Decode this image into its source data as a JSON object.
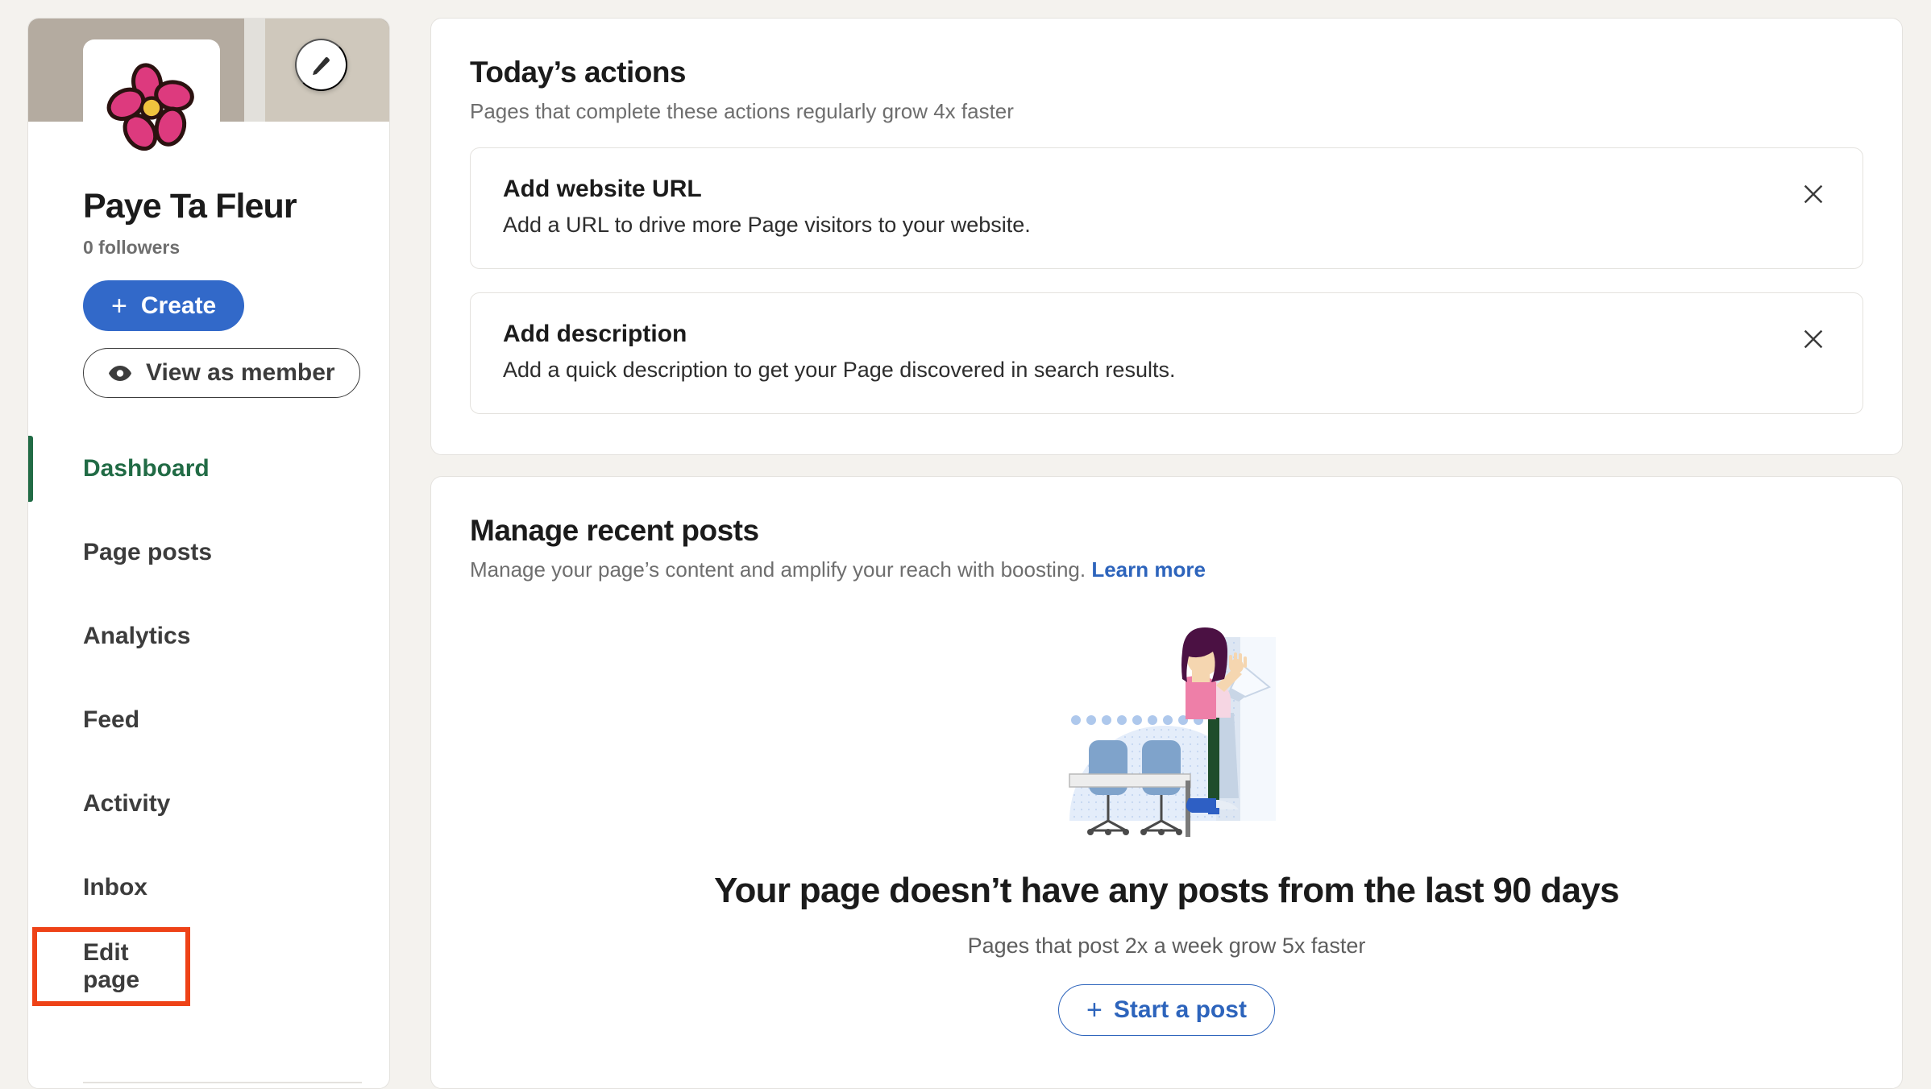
{
  "colors": {
    "app_background": "#F4F2EE",
    "cover": "#B4ABA0",
    "accent_blue": "#3269C9",
    "link_blue": "#2D64BC",
    "active_green": "#216B45",
    "focus_outline": "#EE4217"
  },
  "sidebar": {
    "cover_edit_icon": "pencil-icon",
    "avatar_icon": "flower-avatar",
    "page_name": "Paye Ta Fleur",
    "followers": "0 followers",
    "create_button": {
      "label": "Create",
      "plus": "+"
    },
    "view_as_member_button": {
      "label": "View as member",
      "icon": "eye-icon"
    },
    "nav_items": [
      {
        "label": "Dashboard",
        "state": "active"
      },
      {
        "label": "Page posts",
        "state": "default"
      },
      {
        "label": "Analytics",
        "state": "default"
      },
      {
        "label": "Feed",
        "state": "default"
      },
      {
        "label": "Activity",
        "state": "default"
      },
      {
        "label": "Inbox",
        "state": "default"
      },
      {
        "label": "Edit page",
        "state": "focused"
      }
    ]
  },
  "main": {
    "todays_actions": {
      "title": "Today’s actions",
      "subtitle": "Pages that complete these actions regularly grow 4x faster",
      "items": [
        {
          "title": "Add website URL",
          "description": "Add a URL to drive more Page visitors to your website.",
          "close_icon": "close-icon"
        },
        {
          "title": "Add description",
          "description": "Add a quick description to get your Page discovered in search results.",
          "close_icon": "close-icon"
        }
      ]
    },
    "manage_recent_posts": {
      "title": "Manage recent posts",
      "subtitle": "Manage your page’s content and amplify your reach with boosting.",
      "learn_more": "Learn more",
      "empty_state": {
        "illustration": "person-with-laptop-illustration",
        "title": "Your page doesn’t have any posts from the last 90 days",
        "subtitle": "Pages that post 2x a week grow 5x faster",
        "cta": {
          "label": "Start a post",
          "plus": "+"
        }
      }
    }
  }
}
